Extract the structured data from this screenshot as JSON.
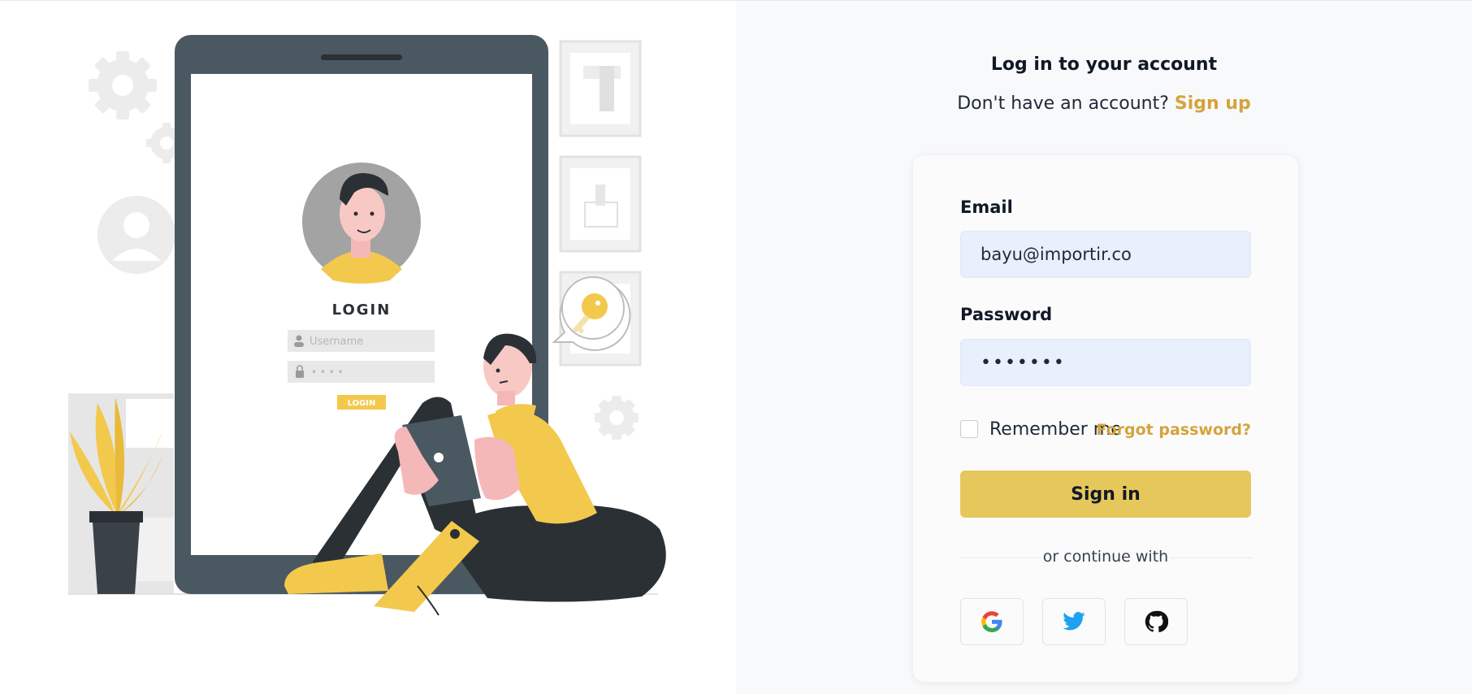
{
  "illustration": {
    "screen_title": "LOGIN",
    "username_placeholder": "Username",
    "password_mask": "• • • •",
    "login_button_label": "LOGIN"
  },
  "header": {
    "title": "Log in to your account",
    "signup_prompt": "Don't have an account?",
    "signup_link": "Sign up"
  },
  "form": {
    "email_label": "Email",
    "email_value": "bayu@importir.co",
    "password_label": "Password",
    "password_value": "•••••••",
    "remember_label": "Remember me",
    "forgot_link": "Forgot password?",
    "signin_label": "Sign in",
    "divider_text": "or continue with"
  },
  "social": [
    {
      "name": "google",
      "icon": "google-icon"
    },
    {
      "name": "twitter",
      "icon": "twitter-icon"
    },
    {
      "name": "github",
      "icon": "github-icon"
    }
  ],
  "colors": {
    "accent": "#d4a33b",
    "button": "#e6c75c",
    "input_bg": "#e8effd",
    "right_bg": "#f8f9fb",
    "illustration_yellow": "#f2c94c",
    "illustration_dark": "#2b3035",
    "phone_frame": "#4a5862"
  }
}
